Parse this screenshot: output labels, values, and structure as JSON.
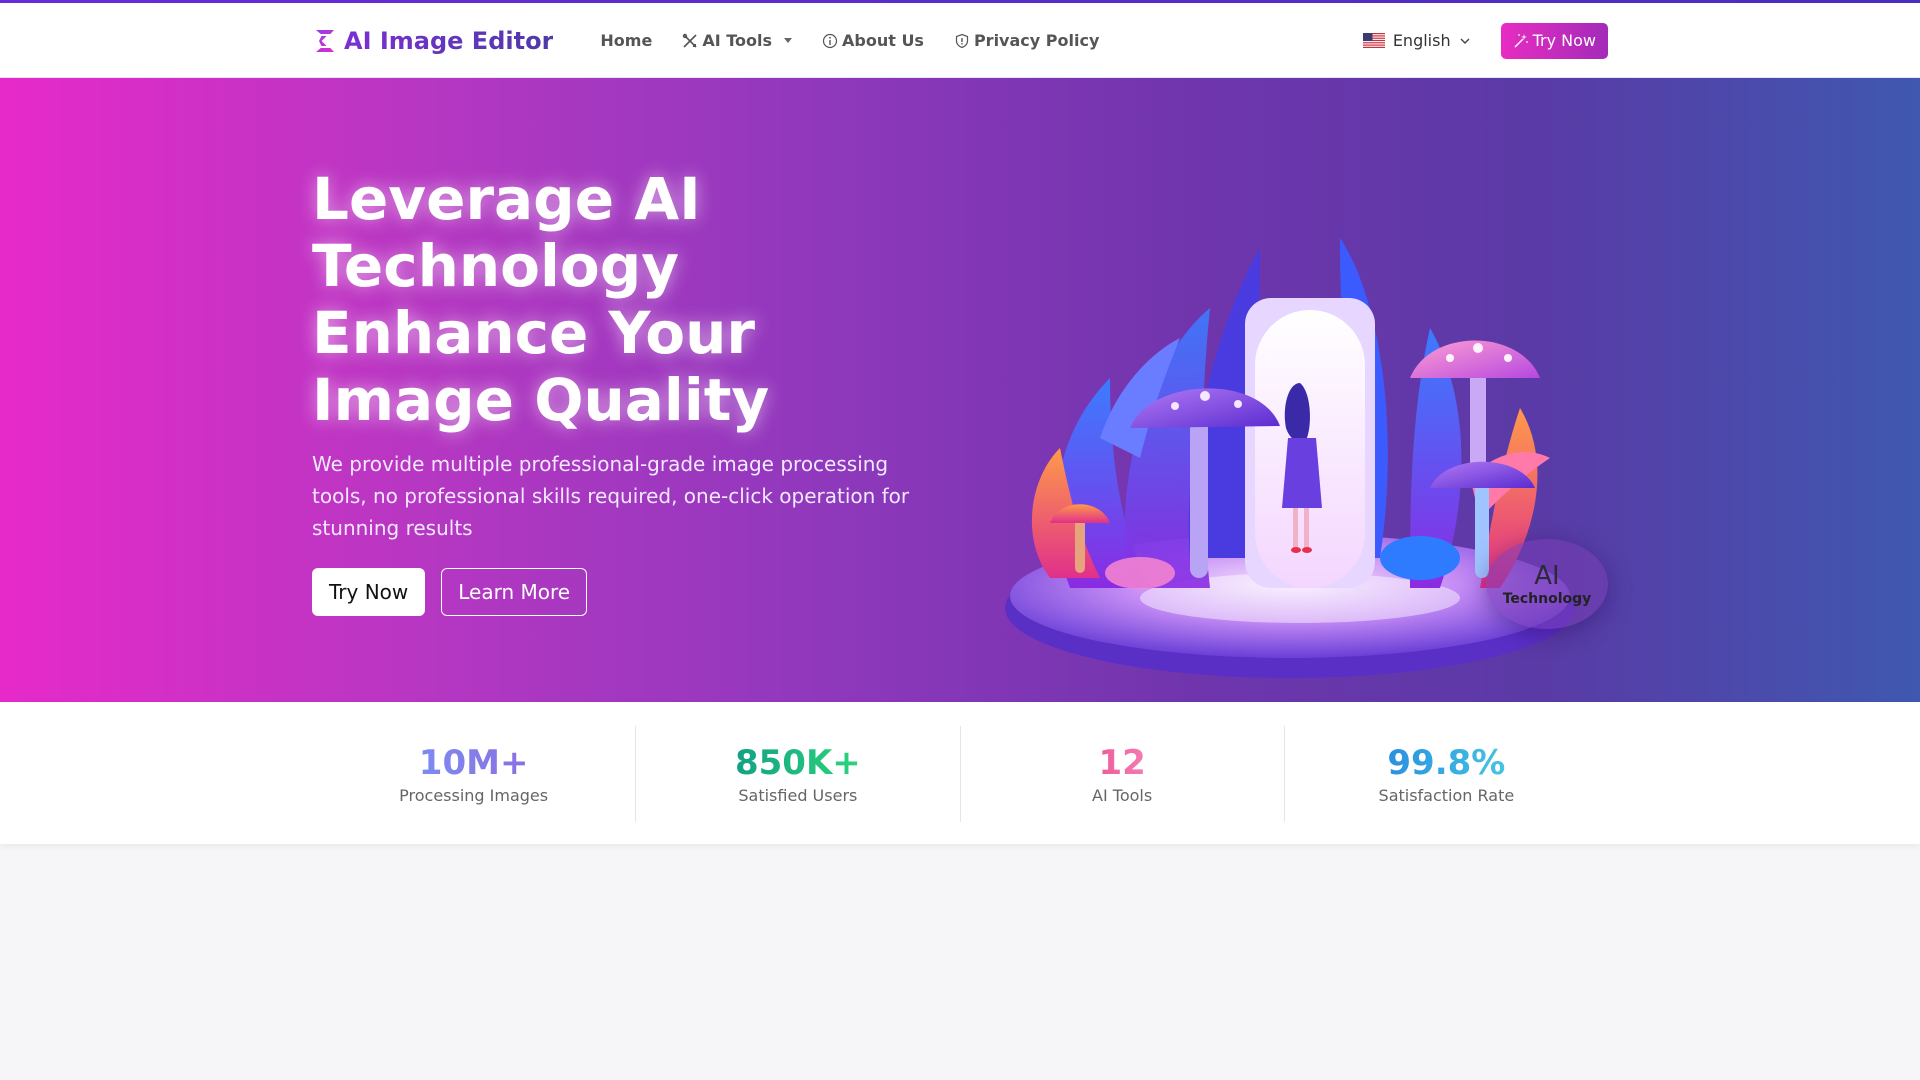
{
  "nav": {
    "brand": "AI Image Editor",
    "links": [
      {
        "label": "Home"
      },
      {
        "label": "AI Tools"
      },
      {
        "label": "About Us"
      },
      {
        "label": "Privacy Policy"
      }
    ],
    "language": "English",
    "cta": "Try Now"
  },
  "hero": {
    "title_lines": [
      "Leverage AI",
      "Technology",
      "Enhance Your",
      "Image Quality"
    ],
    "subtitle": "We provide multiple professional-grade image processing tools, no professional skills required, one-click operation for stunning results",
    "primary_button": "Try Now",
    "secondary_button": "Learn More",
    "badge": {
      "line1": "AI",
      "line2": "Technology"
    }
  },
  "stats": [
    {
      "value": "10M+",
      "label": "Processing Images"
    },
    {
      "value": "850K+",
      "label": "Satisfied Users"
    },
    {
      "value": "12",
      "label": "AI Tools"
    },
    {
      "value": "99.8%",
      "label": "Satisfaction Rate"
    }
  ],
  "colors": {
    "accent_pink": "#e62ac9",
    "accent_purple": "#7a2fd6",
    "hero_end": "#3f58b0"
  },
  "icons": {
    "brand": "brand-s-logo-icon",
    "ai_tools": "tools-icon",
    "about": "info-icon",
    "privacy": "shield-icon",
    "language": "us-flag-icon",
    "cta": "magic-wand-icon"
  }
}
